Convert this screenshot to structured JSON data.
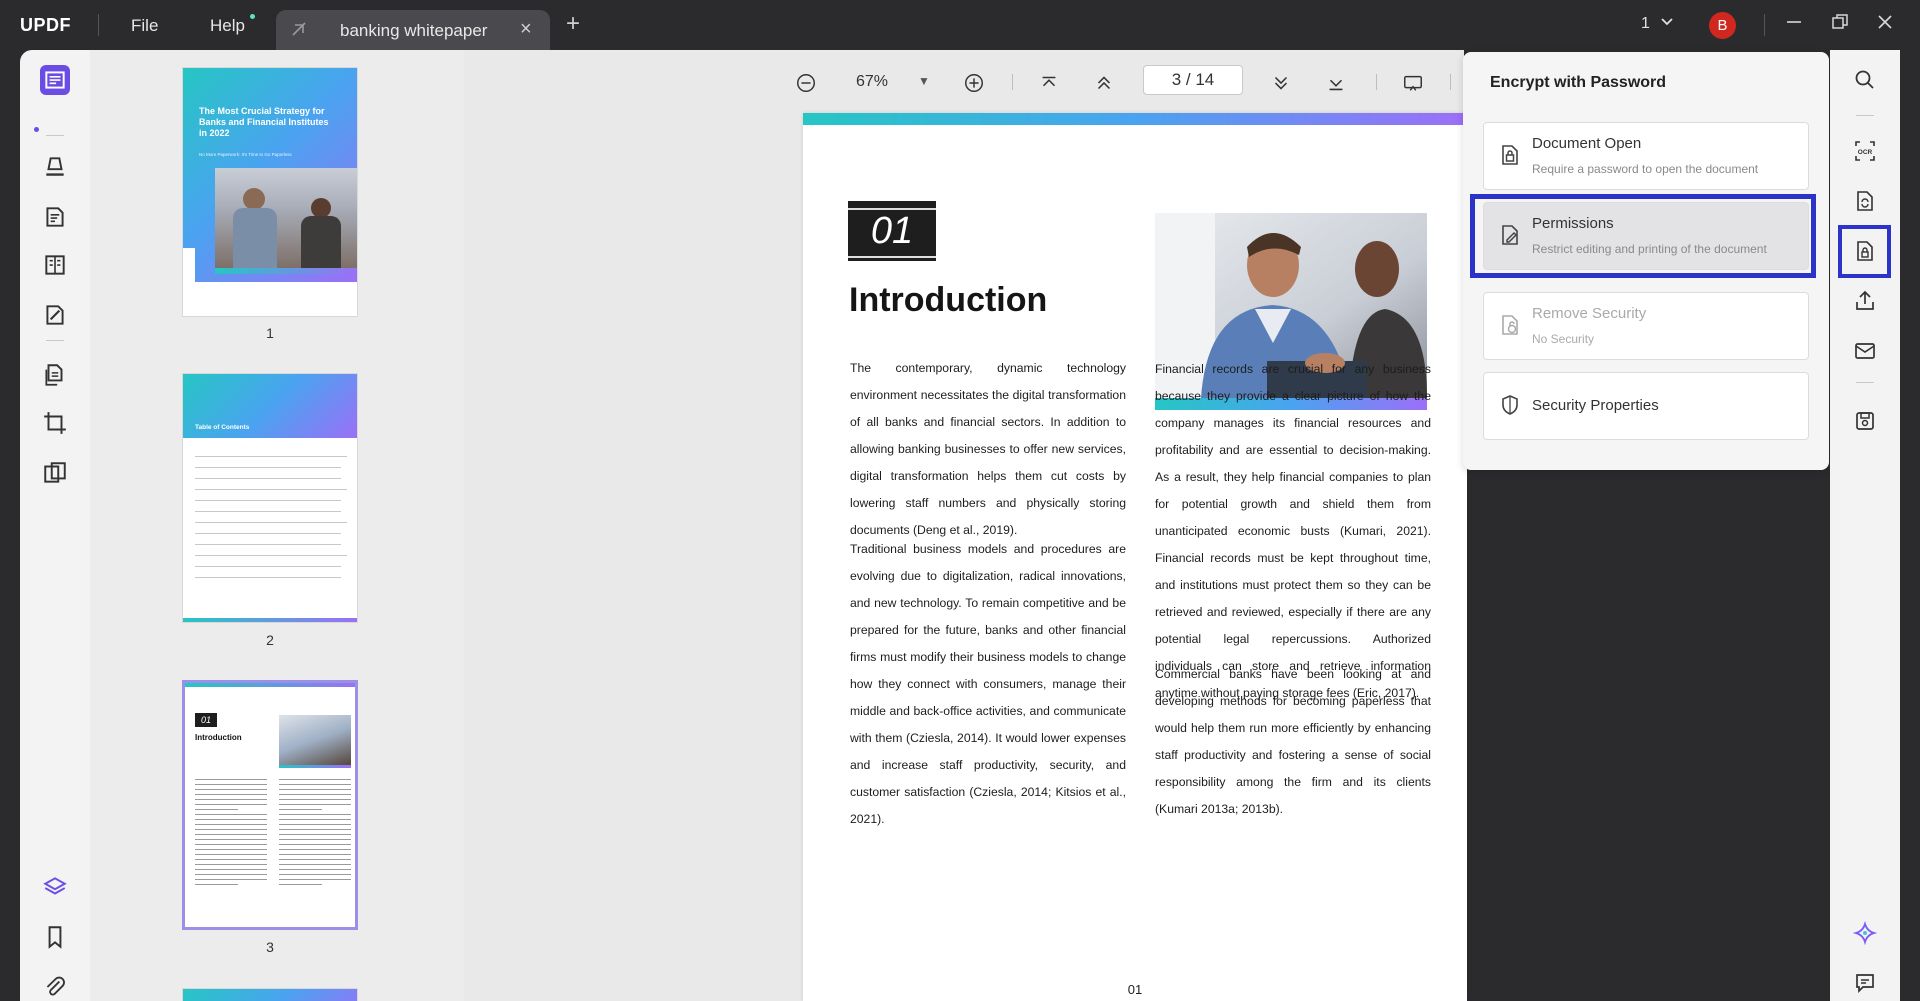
{
  "app": {
    "logo": "UPDF",
    "menu": {
      "file": "File",
      "help": "Help"
    },
    "tab": {
      "title": "banking whitepaper"
    },
    "window_count": "1",
    "avatar_initial": "B"
  },
  "viewer": {
    "zoom": "67%",
    "page_indicator": "3  /  14"
  },
  "thumbnails": [
    {
      "number": "1",
      "title": "The Most Crucial Strategy for Banks and Financial Institutes in 2022",
      "subtitle": "No More Paperwork: It's Time to Go Paperless"
    },
    {
      "number": "2",
      "title": "Table of Contents"
    },
    {
      "number": "3",
      "section": "01",
      "title": "Introduction"
    }
  ],
  "document_page": {
    "section_number": "01",
    "heading": "Introduction",
    "left_paragraphs": [
      "The contemporary, dynamic technology environment necessitates the digital transformation of all banks and financial sectors. In addition to allowing banking businesses to offer new services, digital transformation helps them cut costs by lowering staff numbers and physically storing documents (Deng et al., 2019).",
      "Traditional business models and procedures are evolving due to digitalization, radical innovations, and new technology. To remain competitive and be prepared for the future, banks and other financial firms must modify their business models to change how they connect with consumers, manage their middle and back-office activities, and communicate with them (Cziesla, 2014). It would lower expenses and increase staff productivity, security, and customer satisfaction (Cziesla, 2014; Kitsios et al., 2021)."
    ],
    "right_paragraphs": [
      "Financial records are crucial for any business because they provide a clear picture of how the company manages its financial resources and profitability and are essential to decision-making. As a result, they help financial companies to plan for potential growth and shield them from unanticipated economic busts (Kumari, 2021). Financial records must be kept throughout time, and institutions must protect them so they can be retrieved and reviewed, especially if there are any potential legal repercussions. Authorized individuals can store and retrieve information anytime without paying storage fees (Eric, 2017).",
      "Commercial banks have been looking at and developing methods for becoming paperless that would help them run more efficiently by enhancing staff productivity and fostering a sense of social responsibility among the firm and its clients (Kumari 2013a; 2013b)."
    ],
    "page_footer": "01"
  },
  "encrypt_panel": {
    "title": "Encrypt with Password",
    "items": [
      {
        "title": "Document Open",
        "subtitle": "Require a password to open the document"
      },
      {
        "title": "Permissions",
        "subtitle": "Restrict editing and printing of the document"
      },
      {
        "title": "Remove Security",
        "subtitle": "No Security"
      },
      {
        "title": "Security Properties"
      }
    ]
  },
  "colors": {
    "highlight": "#2c33c9",
    "accent_purple": "#6b4de6",
    "avatar": "#d0281f",
    "titlebar": "#2b2b2e"
  },
  "icons": {
    "left_rail": [
      "reader-icon",
      "highlighter-icon",
      "edit-text-icon",
      "organize-pages-icon",
      "form-icon",
      "convert-icon",
      "crop-icon",
      "compare-icon",
      "layers-icon",
      "bookmark-icon",
      "attachment-icon"
    ],
    "right_rail": [
      "search-icon",
      "ocr-icon",
      "convert-file-icon",
      "protect-icon",
      "share-icon",
      "email-icon",
      "save-icon",
      "ai-assistant-icon",
      "comment-icon"
    ]
  }
}
